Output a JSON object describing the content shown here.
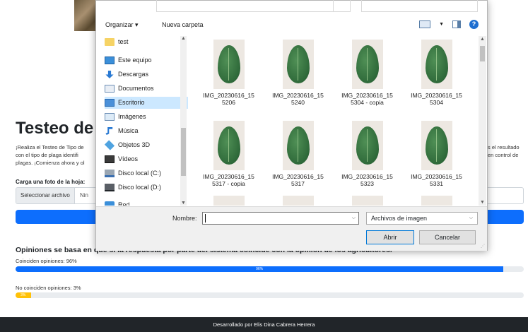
{
  "page": {
    "title": "Testeo de ti",
    "description_lines": [
      "¡Realiza el Testeo de Tipo de",
      "con el tipo de plaga identifi",
      "plagas. ¡Comienza ahora y ol"
    ],
    "description_right_lines": [
      "s el resultado",
      "en control de"
    ],
    "upload_label": "Carga una foto de la hoja:",
    "file_button": "Seleccionar archivo",
    "file_status": "Nin"
  },
  "opinions": {
    "title": "Opiniones se basa en que si la respuesta por parte del sistema coincide con la opinión de los agricultores.",
    "match_label": "Coinciden opiniones: 96%",
    "match_bar_text": "96%",
    "match_value": 96,
    "nomatch_label": "No coinciden opiniones: 3%",
    "nomatch_bar_text": "3%",
    "nomatch_value": 3
  },
  "footer": {
    "text": "Desarrollado por Elis Dina Cabrera Herrera"
  },
  "dialog": {
    "toolbar": {
      "organize": "Organizar ▾",
      "new_folder": "Nueva carpeta",
      "help": "?"
    },
    "nav": [
      {
        "label": "test",
        "icon": "folder-icon"
      },
      {
        "label": "Este equipo",
        "icon": "computer-icon"
      },
      {
        "label": "Descargas",
        "icon": "download-icon"
      },
      {
        "label": "Documentos",
        "icon": "documents-icon"
      },
      {
        "label": "Escritorio",
        "icon": "desktop-icon",
        "selected": true
      },
      {
        "label": "Imágenes",
        "icon": "pictures-icon"
      },
      {
        "label": "Música",
        "icon": "music-icon"
      },
      {
        "label": "Objetos 3D",
        "icon": "objects3d-icon"
      },
      {
        "label": "Vídeos",
        "icon": "videos-icon"
      },
      {
        "label": "Disco local (C:)",
        "icon": "disk-c-icon"
      },
      {
        "label": "Disco local (D:)",
        "icon": "disk-d-icon"
      },
      {
        "label": "Red",
        "icon": "network-icon"
      }
    ],
    "files": [
      {
        "line1": "IMG_20230616_15",
        "line2": "5206"
      },
      {
        "line1": "IMG_20230616_15",
        "line2": "5240"
      },
      {
        "line1": "IMG_20230616_15",
        "line2": "5304 - copia"
      },
      {
        "line1": "IMG_20230616_15",
        "line2": "5304"
      },
      {
        "line1": "IMG_20230616_15",
        "line2": "5317 - copia"
      },
      {
        "line1": "IMG_20230616_15",
        "line2": "5317"
      },
      {
        "line1": "IMG_20230616_15",
        "line2": "5323"
      },
      {
        "line1": "IMG_20230616_15",
        "line2": "5331"
      }
    ],
    "filename_label": "Nombre:",
    "filename_value": "",
    "filetype": "Archivos de imagen",
    "open": "Abrir",
    "cancel": "Cancelar"
  }
}
